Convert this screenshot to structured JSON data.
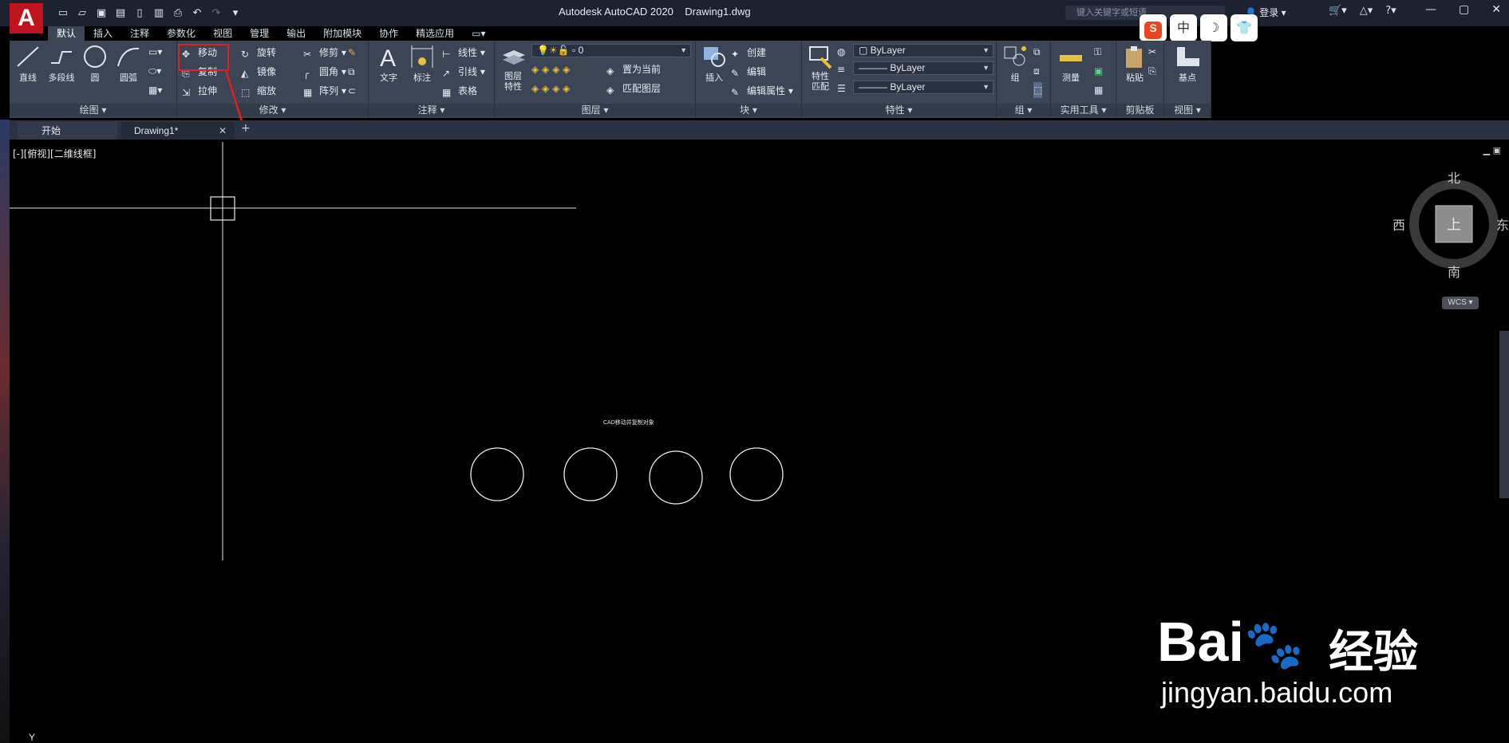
{
  "app": {
    "logo": "A",
    "title": "Autodesk AutoCAD 2020    Drawing1.dwg"
  },
  "title_bar": {
    "search_placeholder": "键入关键字或短语",
    "login": "登录",
    "qat_icons": [
      "new-icon",
      "open-icon",
      "save-icon",
      "save-as-icon",
      "web-icon",
      "publish-icon",
      "print-icon",
      "undo-icon",
      "redo-icon",
      "customize-icon"
    ]
  },
  "ime": {
    "sogou": "S",
    "zh": "中",
    "moon": "☽",
    "shirt": "👕"
  },
  "ribbon_tabs": [
    "默认",
    "插入",
    "注释",
    "参数化",
    "视图",
    "管理",
    "输出",
    "附加模块",
    "协作",
    "精选应用"
  ],
  "panels": {
    "draw": {
      "title": "绘图",
      "line": "直线",
      "polyline": "多段线",
      "circle": "圆",
      "arc": "圆弧"
    },
    "modify": {
      "title": "修改",
      "move": "移动",
      "rotate": "旋转",
      "trim": "修剪",
      "copy": "复制",
      "mirror": "镜像",
      "fillet": "圆角",
      "stretch": "拉伸",
      "scale": "缩放",
      "array": "阵列"
    },
    "annotation": {
      "title": "注释",
      "text": "文字",
      "dimension": "标注",
      "linear": "线性",
      "leader": "引线",
      "table": "表格"
    },
    "layers": {
      "title": "图层",
      "layer_props": "图层\n特性",
      "current_layer": "0",
      "set_current": "置为当前",
      "match_layer": "匹配图层"
    },
    "block": {
      "title": "块",
      "insert": "插入",
      "create": "创建",
      "edit": "编辑",
      "edit_attr": "编辑属性"
    },
    "properties": {
      "title": "特性",
      "match": "特性\n匹配",
      "color": "ByLayer",
      "linetype": "ByLayer",
      "lineweight": "ByLayer"
    },
    "groups": {
      "title": "组",
      "group": "组"
    },
    "utilities": {
      "title": "实用工具",
      "measure": "测量"
    },
    "clipboard": {
      "title": "剪贴板",
      "paste": "粘贴"
    },
    "view": {
      "title": "视图",
      "base": "基点"
    }
  },
  "doc_tabs": {
    "start": "开始",
    "drawing": "Drawing1*"
  },
  "canvas": {
    "view_label": "[-][俯视][二维线框]",
    "viewcube": {
      "north": "北",
      "south": "南",
      "east": "东",
      "west": "西",
      "top": "上"
    },
    "wcs": "WCS",
    "ucs_y": "Y",
    "drawing_text": "CAD移动并复制对象",
    "circles": 4
  },
  "watermark": {
    "brand": "Bai",
    "brand_tail": "经验",
    "url": "jingyan.baidu.com"
  },
  "colors": {
    "titlebar": "#1c2230",
    "ribbon": "#3b4556",
    "canvas": "#000000",
    "accent_red": "#e02020"
  }
}
